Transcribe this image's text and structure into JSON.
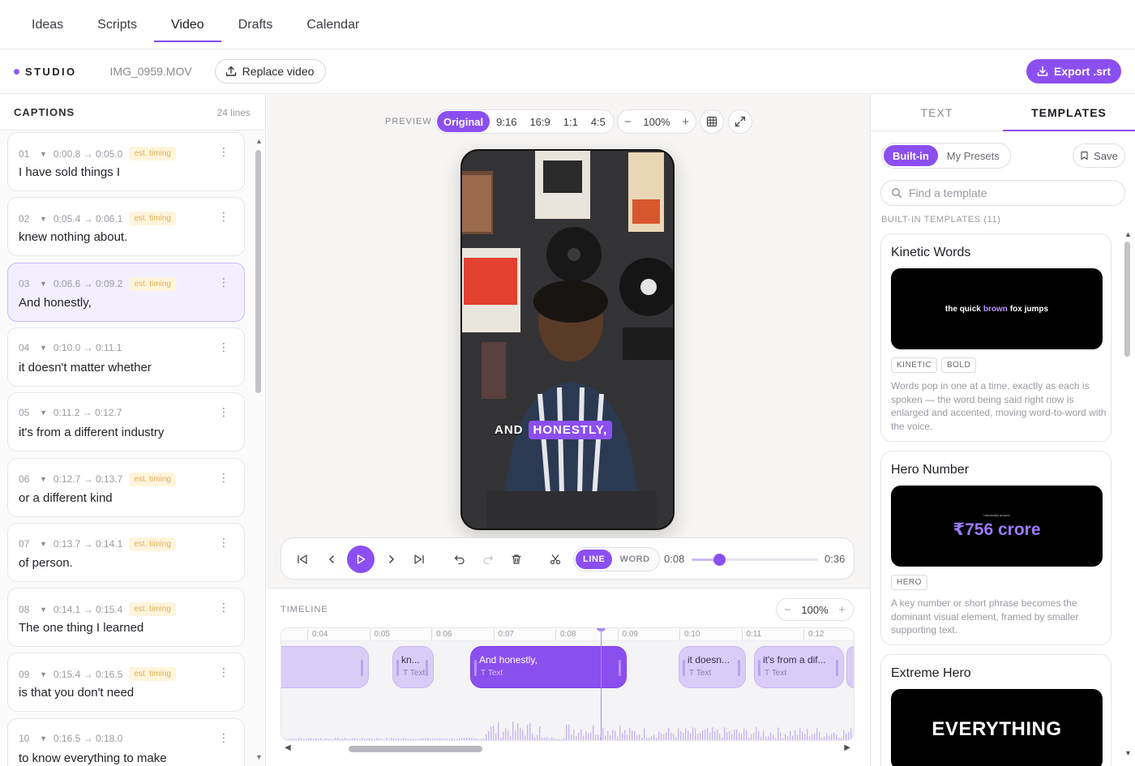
{
  "nav": {
    "tabs": [
      {
        "label": "Ideas"
      },
      {
        "label": "Scripts"
      },
      {
        "label": "Video"
      },
      {
        "label": "Drafts"
      },
      {
        "label": "Calendar"
      }
    ],
    "active": "Video"
  },
  "studio": {
    "brand": "STUDIO",
    "filename": "IMG_0959.MOV",
    "replace_label": "Replace video",
    "export_label": "Export .srt"
  },
  "captions": {
    "title": "CAPTIONS",
    "count": "24 lines",
    "badge": "est. timing",
    "items": [
      {
        "num": "01",
        "time": "0:00.8 → 0:05.0",
        "text": "I have sold things I",
        "badge": true
      },
      {
        "num": "02",
        "time": "0:05.4 → 0:06.1",
        "text": "knew nothing about.",
        "badge": true
      },
      {
        "num": "03",
        "time": "0:06.6 → 0:09.2",
        "text": "And honestly,",
        "badge": true,
        "active": true
      },
      {
        "num": "04",
        "time": "0:10.0 → 0:11.1",
        "text": "it doesn't matter whether",
        "badge": false
      },
      {
        "num": "05",
        "time": "0:11.2 → 0:12.7",
        "text": "it's from a different industry",
        "badge": false
      },
      {
        "num": "06",
        "time": "0:12.7 → 0:13.7",
        "text": "or a different kind",
        "badge": true
      },
      {
        "num": "07",
        "time": "0:13.7 → 0:14.1",
        "text": "of person.",
        "badge": true
      },
      {
        "num": "08",
        "time": "0:14.1 → 0:15.4",
        "text": "The one thing I learned",
        "badge": true
      },
      {
        "num": "09",
        "time": "0:15.4 → 0:16.5",
        "text": "is that you don't need",
        "badge": true
      },
      {
        "num": "10",
        "time": "0:16.5 → 0:18.0",
        "text": "to know everything to make",
        "badge": false
      }
    ]
  },
  "preview": {
    "label": "PREVIEW",
    "ratios": [
      "Original",
      "9:16",
      "16:9",
      "1:1",
      "4:5"
    ],
    "active_ratio": "Original",
    "zoom": "100%",
    "caption_words": [
      "AND",
      "HONESTLY,"
    ]
  },
  "player": {
    "mode_line": "LINE",
    "mode_word": "WORD",
    "active_mode": "LINE",
    "current": "0:08",
    "total": "0:36",
    "progress": 0.22
  },
  "timeline": {
    "label": "TIMELINE",
    "zoom": "100%",
    "ticks": [
      "0:04",
      "0:05",
      "0:06",
      "0:07",
      "0:08",
      "0:09",
      "0:10",
      "0:11",
      "0:12"
    ],
    "clips": [
      {
        "text": "",
        "sub": ""
      },
      {
        "text": "kn...",
        "sub": "Text"
      },
      {
        "text": "And honestly,",
        "sub": "Text",
        "active": true
      },
      {
        "text": "it doesn...",
        "sub": "Text"
      },
      {
        "text": "it's from a dif...",
        "sub": "Text"
      }
    ]
  },
  "right": {
    "tabs": [
      "TEXT",
      "TEMPLATES"
    ],
    "active_tab": "TEMPLATES",
    "seg": [
      "Built-in",
      "My Presets"
    ],
    "save_label": "Save",
    "search_placeholder": "Find a template",
    "section": "BUILT-IN TEMPLATES (11)",
    "cards": [
      {
        "name": "Kinetic Words",
        "preview_a": "the quick",
        "preview_b": "brown",
        "preview_c": "fox jumps",
        "tags": [
          "KINETIC",
          "BOLD"
        ],
        "desc": "Words pop in one at a time, exactly as each is spoken — the word being said right now is enlarged and accented, moving word-to-word with the voice."
      },
      {
        "name": "Hero Number",
        "preview_small": "historically around",
        "preview_big": "₹756 crore",
        "tags": [
          "HERO"
        ],
        "desc": "A key number or short phrase becomes the dominant visual element, framed by smaller supporting text."
      },
      {
        "name": "Extreme Hero",
        "preview_big": "EVERYTHING",
        "tags": [],
        "desc": ""
      }
    ]
  },
  "colors": {
    "accent": "#8b4ff0",
    "accent_soft": "#d9ccf7",
    "badge_text": "#e0b055",
    "badge_bg": "#fff5dc"
  }
}
